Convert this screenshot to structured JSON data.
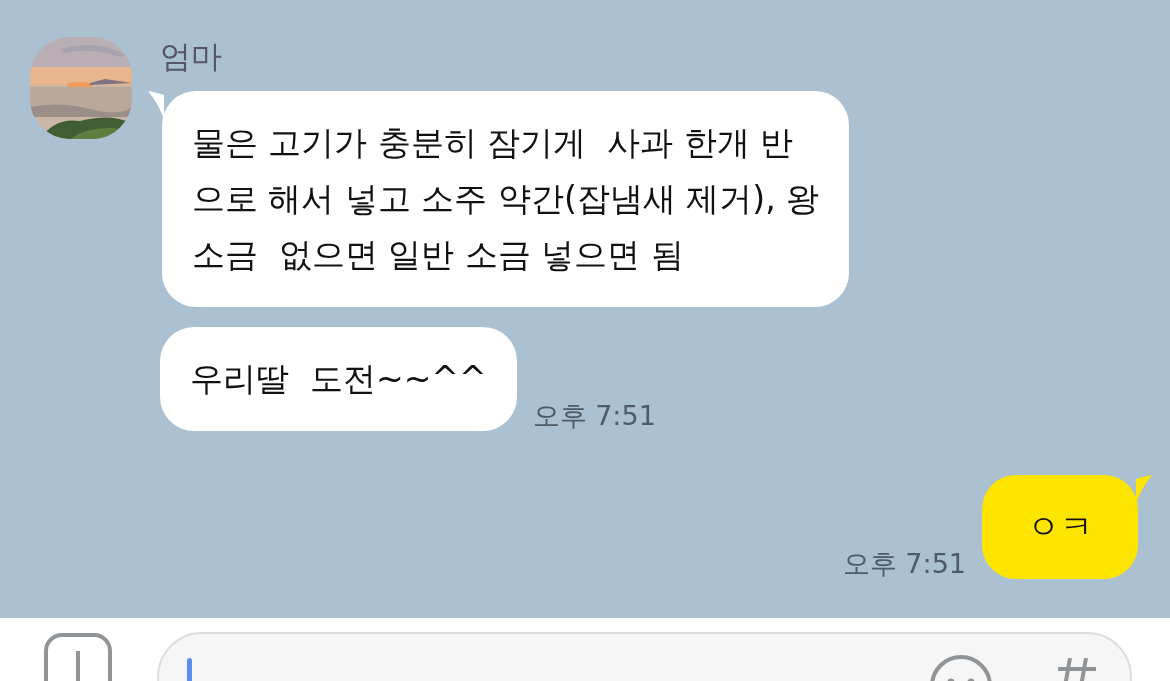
{
  "messages": [
    {
      "kind": "received",
      "sender": "엄마",
      "avatar": {
        "kind": "picture"
      },
      "bubbles": [
        {
          "lines": [
            "물은 고기가 충분히 잠기게  사과 한개 반",
            "으로 해서 넣고 소주 약간(잡냄새 제거), 왕",
            "소금  없으면 일반 소금 넣으면 됨"
          ]
        },
        {
          "lines": [
            "우리딸  도전~~^^"
          ]
        }
      ],
      "time": "오후 7:51"
    },
    {
      "kind": "sent",
      "bubbles": [
        {
          "lines": [
            "ㅇㅋ"
          ]
        }
      ],
      "time": "오후 7:51"
    }
  ]
}
